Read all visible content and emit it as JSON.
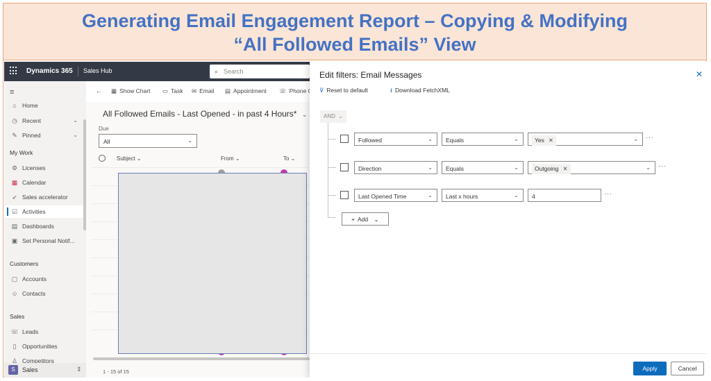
{
  "banner": {
    "line1": "Generating Email Engagement Report – Copying & Modifying",
    "line2": "“All Followed Emails” View"
  },
  "topbar": {
    "app_name": "Dynamics 365",
    "hub_name": "Sales Hub",
    "search_placeholder": "Search"
  },
  "sidebar": {
    "top_items": [
      {
        "label": "Home",
        "icon": "home-icon"
      },
      {
        "label": "Recent",
        "icon": "clock-icon"
      },
      {
        "label": "Pinned",
        "icon": "pin-icon"
      }
    ],
    "sections": [
      {
        "title": "My Work",
        "items": [
          "Licenses",
          "Calendar",
          "Sales accelerator",
          "Activities",
          "Dashboards",
          "Set Personal Notif..."
        ]
      },
      {
        "title": "Customers",
        "items": [
          "Accounts",
          "Contacts"
        ]
      },
      {
        "title": "Sales",
        "items": [
          "Leads",
          "Opportunities",
          "Competitors"
        ]
      }
    ],
    "active_item": "Activities",
    "area_badge": "S",
    "area_label": "Sales"
  },
  "commandbar": {
    "show_chart": "Show Chart",
    "task": "Task",
    "email": "Email",
    "appointment": "Appointment",
    "phone_call": "Phone C"
  },
  "view": {
    "title": "All Followed Emails - Last Opened - in past 4 Hours*",
    "due_label": "Due",
    "due_value": "All",
    "columns": {
      "subject": "Subject",
      "from": "From",
      "to": "To"
    },
    "record_count": "1 - 15 of 15"
  },
  "panel": {
    "title": "Edit filters: Email Messages",
    "reset": "Reset to default",
    "download": "Download FetchXML",
    "group_operator": "AND",
    "filters": [
      {
        "field": "Followed",
        "operator": "Equals",
        "value": "Yes",
        "value_type": "tag"
      },
      {
        "field": "Direction",
        "operator": "Equals",
        "value": "Outgoing",
        "value_type": "tag"
      },
      {
        "field": "Last Opened Time",
        "operator": "Last x hours",
        "value": "4",
        "value_type": "text"
      }
    ],
    "add_label": "Add",
    "apply": "Apply",
    "cancel": "Cancel"
  },
  "colors": {
    "banner_bg": "#fbe5d6",
    "banner_text": "#4472c4",
    "topbar_bg": "#343a45",
    "accent": "#0f6cbd"
  }
}
